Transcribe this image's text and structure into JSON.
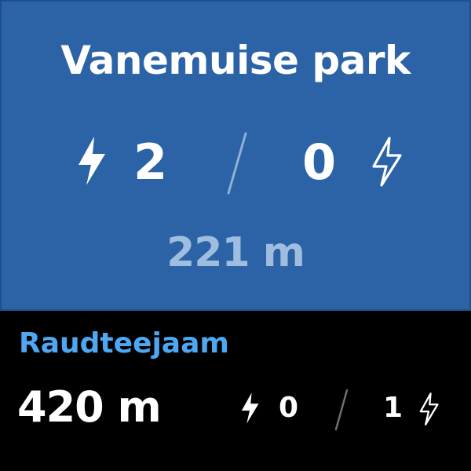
{
  "colors": {
    "card_background": "#2b63a6",
    "primary_text": "#ffffff",
    "distance_text": "#9fbedf",
    "next_station_name": "#4ea7f2",
    "background": "#000000"
  },
  "current_station": {
    "name": "Vanemuise park",
    "available_bikes": "2",
    "free_docks": "0",
    "distance": "221 m",
    "bikes_icon": "lightning-filled-icon",
    "docks_icon": "lightning-outline-icon"
  },
  "next_station": {
    "name": "Raudteejaam",
    "distance": "420 m",
    "available_bikes": "0",
    "free_docks": "1",
    "bikes_icon": "lightning-filled-icon",
    "docks_icon": "lightning-outline-icon"
  }
}
